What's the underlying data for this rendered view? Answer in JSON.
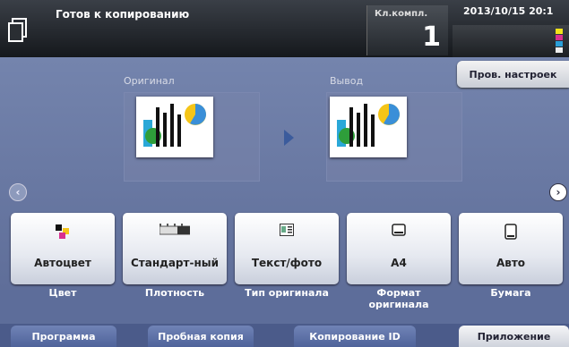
{
  "header": {
    "status": "Готов к копированию",
    "count_label": "Кл.компл.",
    "count_value": "1",
    "datetime": "2013/10/15 20:1",
    "toner_colors": [
      "#f2e21a",
      "#d8308f",
      "#2a9fd8",
      "#111111"
    ],
    "toner_labels": [
      "Y",
      "M",
      "C",
      "K"
    ]
  },
  "verify_button": "Пров. настроек",
  "preview": {
    "original_label": "Оригинал",
    "output_label": "Вывод"
  },
  "functions": [
    {
      "value": "Автоцвет",
      "caption": "Цвет",
      "icon": "color-squares-icon"
    },
    {
      "value": "Стандарт-ный",
      "caption": "Плотность",
      "icon": "density-scale-icon"
    },
    {
      "value": "Текст/фото",
      "caption": "Тип оригинала",
      "icon": "text-photo-icon"
    },
    {
      "value": "A4",
      "caption": "Формат оригинала",
      "icon": "original-size-icon"
    },
    {
      "value": "Авто",
      "caption": "Бумага",
      "icon": "paper-icon"
    }
  ],
  "tabs": [
    {
      "label": "Программа"
    },
    {
      "label": "Пробная копия"
    },
    {
      "label": "Копирование ID"
    },
    {
      "label": "Приложение"
    }
  ]
}
